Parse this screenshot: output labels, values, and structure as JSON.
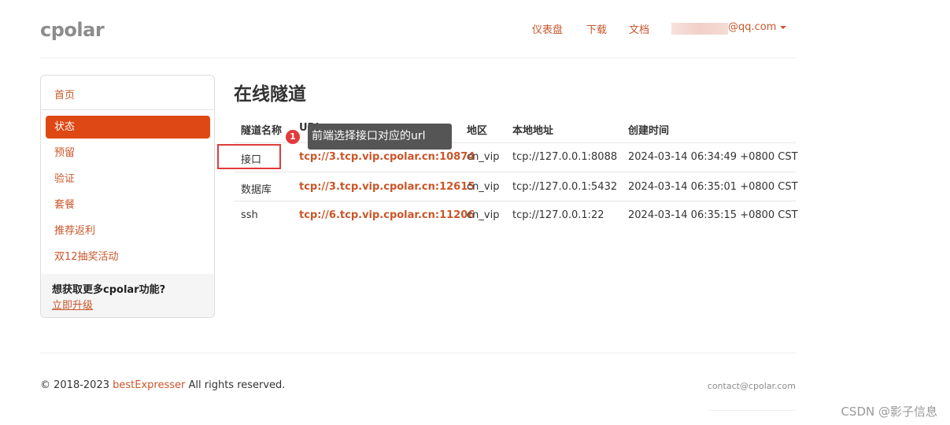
{
  "header": {
    "logo": "cpolar",
    "nav": [
      "仪表盘",
      "下载",
      "文档"
    ],
    "email_suffix": "@qq.com"
  },
  "sidebar": {
    "home": "首页",
    "items": [
      {
        "label": "状态",
        "active": true
      },
      {
        "label": "预留",
        "active": false
      },
      {
        "label": "验证",
        "active": false
      },
      {
        "label": "套餐",
        "active": false
      },
      {
        "label": "推荐返利",
        "active": false
      },
      {
        "label": "双12抽奖活动",
        "active": false
      }
    ],
    "promo_title": "想获取更多cpolar功能?",
    "promo_link": "立即升级"
  },
  "main": {
    "title": "在线隧道",
    "columns": [
      "隧道名称",
      "URL",
      "地区",
      "本地地址",
      "创建时间"
    ],
    "rows": [
      {
        "name": "接口",
        "url": "tcp://3.tcp.vip.cpolar.cn:10874",
        "region": "cn_vip",
        "local": "tcp://127.0.0.1:8088",
        "created": "2024-03-14 06:34:49 +0800 CST"
      },
      {
        "name": "数据库",
        "url": "tcp://3.tcp.vip.cpolar.cn:12615",
        "region": "cn_vip",
        "local": "tcp://127.0.0.1:5432",
        "created": "2024-03-14 06:35:01 +0800 CST"
      },
      {
        "name": "ssh",
        "url": "tcp://6.tcp.vip.cpolar.cn:11206",
        "region": "cn_vip",
        "local": "tcp://127.0.0.1:22",
        "created": "2024-03-14 06:35:15 +0800 CST"
      }
    ]
  },
  "annotation": {
    "badge": "1",
    "tooltip": "前端选择接口对应的url"
  },
  "footer": {
    "copyright_prefix": "© 2018-2023 ",
    "brand": "bestExpresser",
    "copyright_suffix": " All rights reserved.",
    "contact": "contact@cpolar.com"
  },
  "watermark": "CSDN @影子信息",
  "colors": {
    "accent": "#dd4814",
    "link": "#c9562a",
    "annotation_red": "#e03b3b",
    "tooltip_bg": "#555555"
  }
}
